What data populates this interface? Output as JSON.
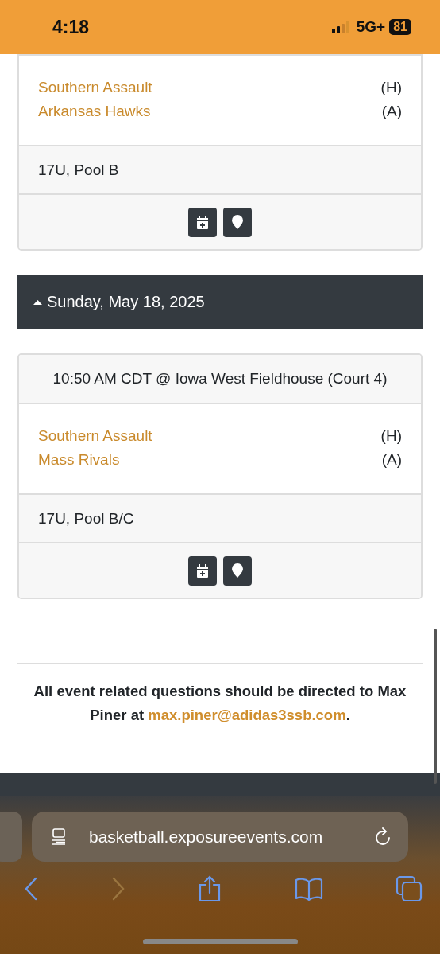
{
  "status_bar": {
    "time": "4:18",
    "network": "5G+",
    "battery": "81"
  },
  "games": [
    {
      "teams": [
        {
          "name": "Southern Assault",
          "side": "(H)"
        },
        {
          "name": "Arkansas Hawks",
          "side": "(A)"
        }
      ],
      "category": "17U, Pool B"
    }
  ],
  "date_header": {
    "label": "Sunday, May 18, 2025",
    "expanded": true
  },
  "games_after": [
    {
      "time": "10:50 AM CDT @ Iowa West Fieldhouse (Court 4)",
      "teams": [
        {
          "name": "Southern Assault",
          "side": "(H)"
        },
        {
          "name": "Mass Rivals",
          "side": "(A)"
        }
      ],
      "category": "17U, Pool B/C"
    }
  ],
  "contact": {
    "text": "All event related questions should be directed to Max Piner at",
    "email": "max.piner@adidas3ssb.com",
    "end": "."
  },
  "browser": {
    "url": "basketball.exposureevents.com"
  }
}
